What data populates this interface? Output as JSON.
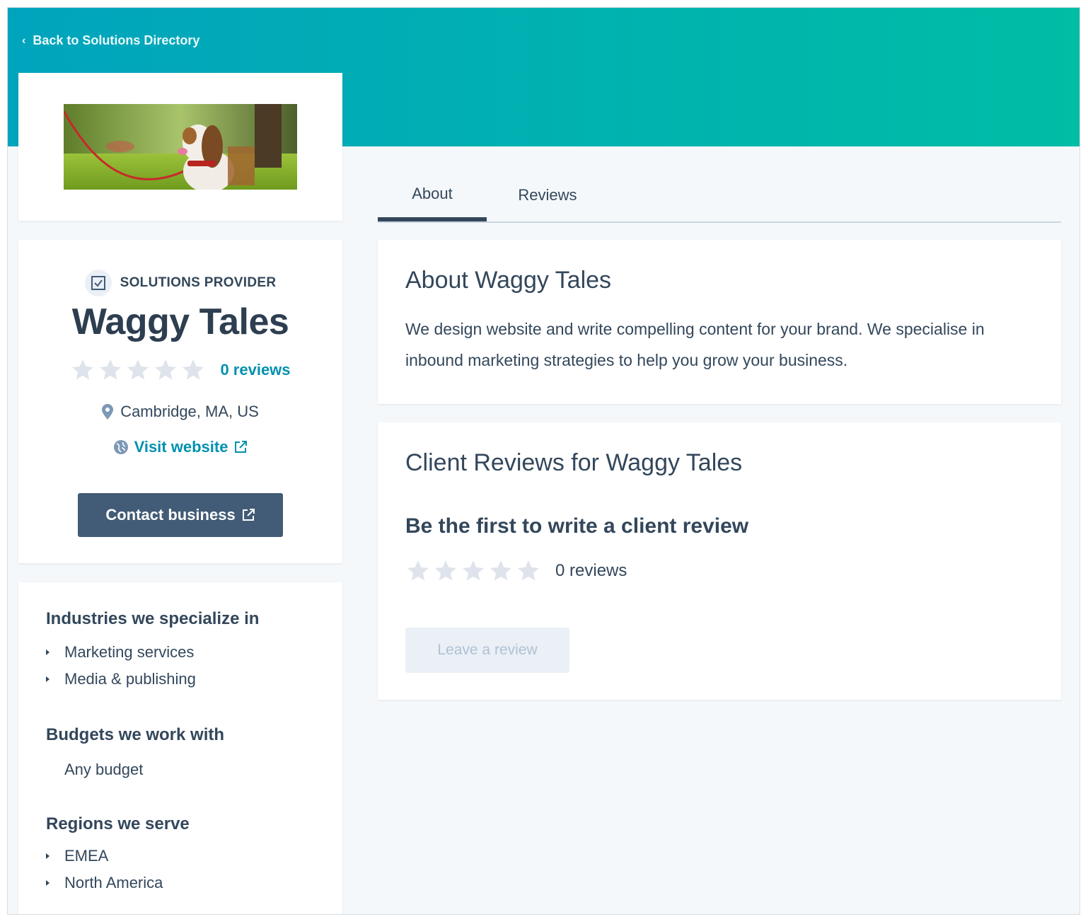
{
  "back_link": {
    "label": "Back to Solutions Directory"
  },
  "provider": {
    "badge": "SOLUTIONS PROVIDER",
    "name": "Waggy Tales",
    "rating": 0,
    "reviews_label": "0 reviews",
    "location": "Cambridge, MA, US",
    "website_label": "Visit website",
    "contact_label": "Contact business"
  },
  "details": {
    "industries_title": "Industries we specialize in",
    "industries": [
      "Marketing services",
      "Media & publishing"
    ],
    "budgets_title": "Budgets we work with",
    "budget": "Any budget",
    "regions_title": "Regions we serve",
    "regions": [
      "EMEA",
      "North America"
    ]
  },
  "tabs": [
    {
      "label": "About",
      "active": true
    },
    {
      "label": "Reviews",
      "active": false
    }
  ],
  "about": {
    "title": "About Waggy Tales",
    "body": "We design website and write compelling content for your brand. We specialise in inbound marketing strategies to help you grow your business."
  },
  "client_reviews": {
    "title": "Client Reviews for Waggy Tales",
    "subtitle": "Be the first to write a client review",
    "rating": 0,
    "count_label": "0 reviews",
    "leave_label": "Leave a review"
  },
  "colors": {
    "banner_start": "#00a4bd",
    "banner_end": "#00bda5",
    "link": "#0091ae",
    "primary_button": "#425b76",
    "text": "#33475b",
    "star_empty": "#dfe3eb"
  }
}
